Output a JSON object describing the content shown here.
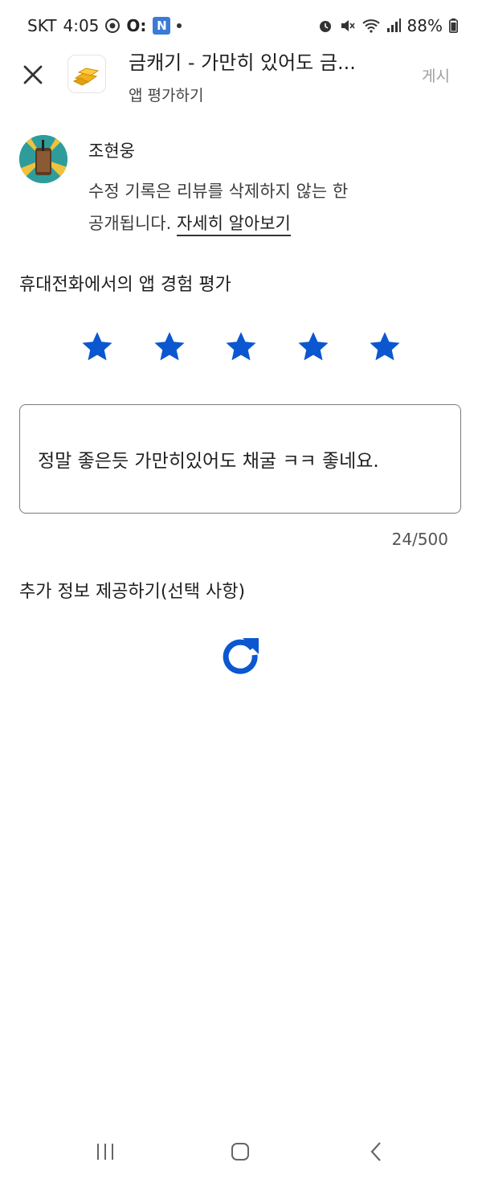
{
  "status_bar": {
    "carrier": "SKT",
    "time": "4:05",
    "notif_text": "O:",
    "notif_badge": "N",
    "battery": "88%"
  },
  "header": {
    "app_title": "금캐기 - 가만히 있어도 금...",
    "subtitle": "앱 평가하기",
    "post_label": "게시"
  },
  "user": {
    "name": "조현웅",
    "notice_line1": "수정 기록은 리뷰를 삭제하지 않는 한",
    "notice_line2_prefix": "공개됩니다. ",
    "learn_more": "자세히 알아보기"
  },
  "rating": {
    "label": "휴대전화에서의 앱 경험 평가",
    "stars_selected": 5,
    "stars_total": 5,
    "star_color": "#0b57d0"
  },
  "review": {
    "text": "정말 좋은듯 가만히있어도 채굴 ㅋㅋ 좋네요.",
    "counter": "24/500"
  },
  "extra_info": {
    "label": "추가 정보 제공하기(선택 사항)"
  },
  "icons": {
    "close": "close-icon",
    "refresh": "refresh-icon",
    "accent": "#0b57d0"
  }
}
